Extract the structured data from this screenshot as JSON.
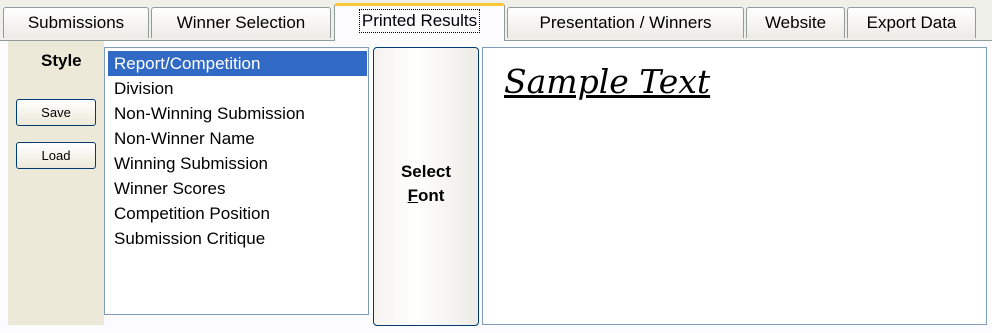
{
  "tabs": [
    {
      "label": "Submissions"
    },
    {
      "label": "Winner Selection"
    },
    {
      "label": "Printed Results"
    },
    {
      "label": "Presentation / Winners"
    },
    {
      "label": "Website"
    },
    {
      "label": "Export Data"
    }
  ],
  "style_panel": {
    "title": "Style",
    "save_label": "Save",
    "load_label": "Load"
  },
  "style_list": {
    "items": [
      "Report/Competition",
      "Division",
      "Non-Winning Submission",
      "Non-Winner Name",
      "Winning Submission",
      "Winner Scores",
      "Competition Position",
      "Submission Critique"
    ],
    "selected": "Report/Competition"
  },
  "font_button": {
    "line1": "Select",
    "line2_accel": "F",
    "line2_rest": "ont"
  },
  "preview": {
    "sample_text": "Sample Text"
  },
  "colors": {
    "selection": "#316ac5",
    "active_tab_accent": "#ffc83c",
    "panel_bg": "#ece9d8"
  }
}
